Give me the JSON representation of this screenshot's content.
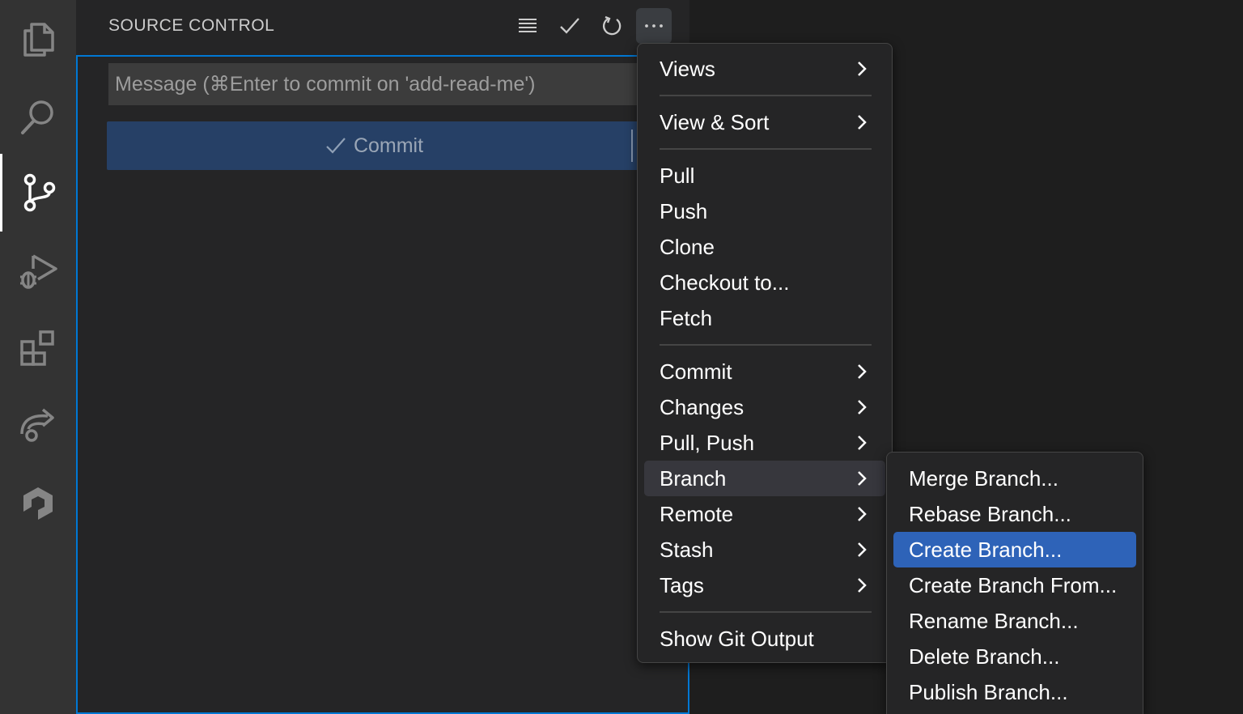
{
  "activity_bar": {
    "items": [
      {
        "name": "explorer",
        "icon": "files-icon"
      },
      {
        "name": "search",
        "icon": "search-icon"
      },
      {
        "name": "source-control",
        "icon": "source-control-icon",
        "active": true
      },
      {
        "name": "run-debug",
        "icon": "run-debug-icon"
      },
      {
        "name": "extensions",
        "icon": "extensions-icon"
      },
      {
        "name": "remote-explorer",
        "icon": "remote-explorer-icon"
      },
      {
        "name": "extension-view",
        "icon": "hexagon-logo-icon"
      }
    ]
  },
  "sidebar": {
    "title": "SOURCE CONTROL",
    "header_actions": [
      "list-view-icon",
      "checkmark-icon",
      "refresh-icon",
      "ellipsis-icon"
    ],
    "message_placeholder": "Message (⌘Enter to commit on 'add-read-me')",
    "message_value": "",
    "commit_label": "Commit"
  },
  "main_menu": {
    "items": [
      {
        "label": "Views",
        "submenu": true
      },
      {
        "label": "View & Sort",
        "submenu": true
      },
      {
        "label": "Pull"
      },
      {
        "label": "Push"
      },
      {
        "label": "Clone"
      },
      {
        "label": "Checkout to..."
      },
      {
        "label": "Fetch"
      },
      {
        "label": "Commit",
        "submenu": true
      },
      {
        "label": "Changes",
        "submenu": true
      },
      {
        "label": "Pull, Push",
        "submenu": true
      },
      {
        "label": "Branch",
        "submenu": true,
        "highlighted": true
      },
      {
        "label": "Remote",
        "submenu": true
      },
      {
        "label": "Stash",
        "submenu": true
      },
      {
        "label": "Tags",
        "submenu": true
      },
      {
        "label": "Show Git Output"
      }
    ]
  },
  "branch_submenu": {
    "items": [
      {
        "label": "Merge Branch..."
      },
      {
        "label": "Rebase Branch..."
      },
      {
        "label": "Create Branch...",
        "selected": true
      },
      {
        "label": "Create Branch From..."
      },
      {
        "label": "Rename Branch..."
      },
      {
        "label": "Delete Branch..."
      },
      {
        "label": "Publish Branch..."
      }
    ]
  },
  "colors": {
    "accent": "#0078d4",
    "menu_selection": "#2e63b8",
    "commit_button": "#264066"
  }
}
